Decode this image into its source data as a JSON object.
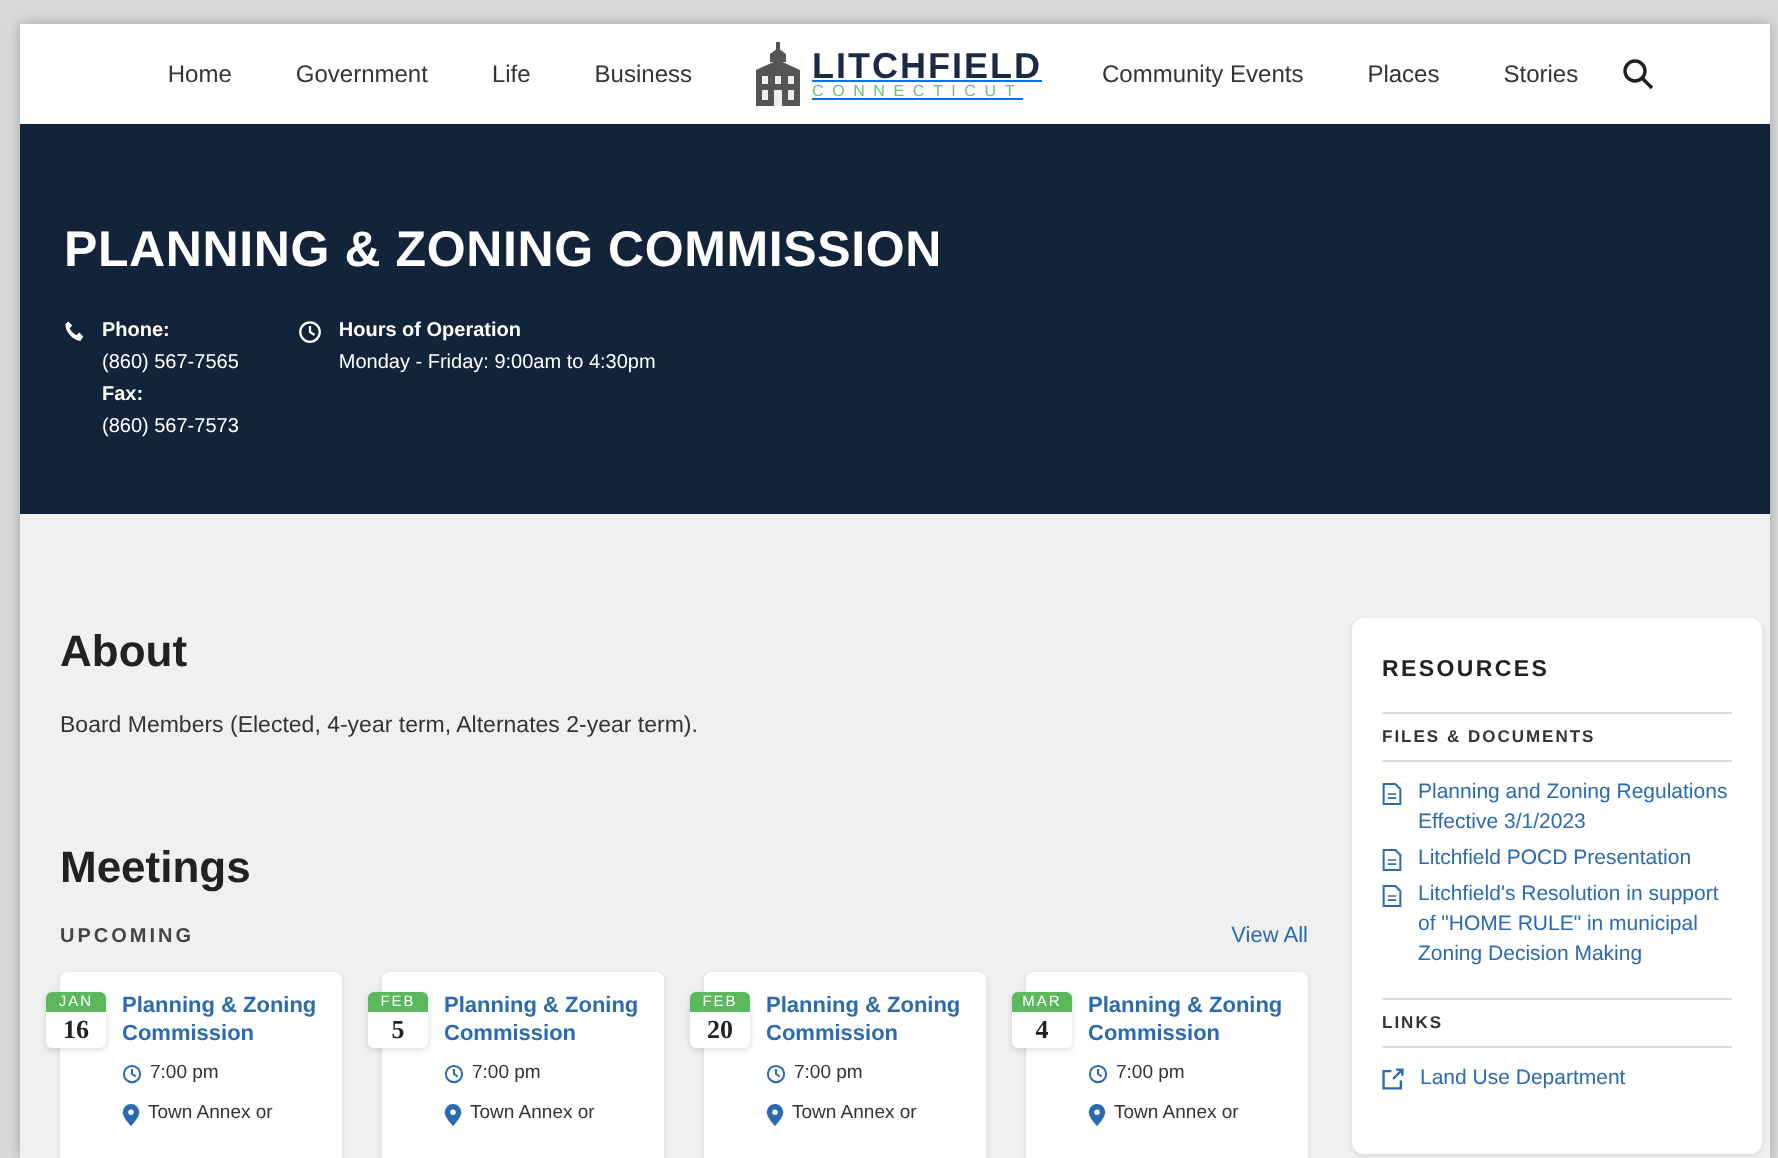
{
  "nav": {
    "left": [
      "Home",
      "Government",
      "Life",
      "Business"
    ],
    "logo": {
      "name": "LITCHFIELD",
      "sub": "CONNECTICUT"
    },
    "right": [
      "Community Events",
      "Places",
      "Stories"
    ]
  },
  "hero": {
    "title": "PLANNING & ZONING COMMISSION",
    "phone_label": "Phone:",
    "phone": "(860) 567-7565",
    "fax_label": "Fax:",
    "fax": "(860) 567-7573",
    "hours_label": "Hours of Operation",
    "hours": "Monday - Friday: 9:00am to 4:30pm"
  },
  "about": {
    "heading": "About",
    "text": "Board Members (Elected, 4-year term, Alternates 2-year term)."
  },
  "meetings": {
    "heading": "Meetings",
    "subheading": "UPCOMING",
    "view_all": "View All",
    "items": [
      {
        "month": "JAN",
        "day": "16",
        "title": "Planning & Zoning Commission",
        "time": "7:00 pm",
        "place": "Town Annex or"
      },
      {
        "month": "FEB",
        "day": "5",
        "title": "Planning & Zoning Commission",
        "time": "7:00 pm",
        "place": "Town Annex or"
      },
      {
        "month": "FEB",
        "day": "20",
        "title": "Planning & Zoning Commission",
        "time": "7:00 pm",
        "place": "Town Annex or"
      },
      {
        "month": "MAR",
        "day": "4",
        "title": "Planning & Zoning Commission",
        "time": "7:00 pm",
        "place": "Town Annex or"
      }
    ]
  },
  "resources": {
    "title": "RESOURCES",
    "sections": [
      {
        "heading": "FILES & DOCUMENTS",
        "items": [
          {
            "kind": "file",
            "label": "Planning and Zoning Regulations Effective 3/1/2023"
          },
          {
            "kind": "file",
            "label": "Litchfield POCD Presentation"
          },
          {
            "kind": "file",
            "label": "Litchfield's Resolution in support of \"HOME RULE\" in municipal Zoning Decision Making"
          }
        ]
      },
      {
        "heading": "LINKS",
        "items": [
          {
            "kind": "link",
            "label": "Land Use Department"
          }
        ]
      }
    ]
  }
}
